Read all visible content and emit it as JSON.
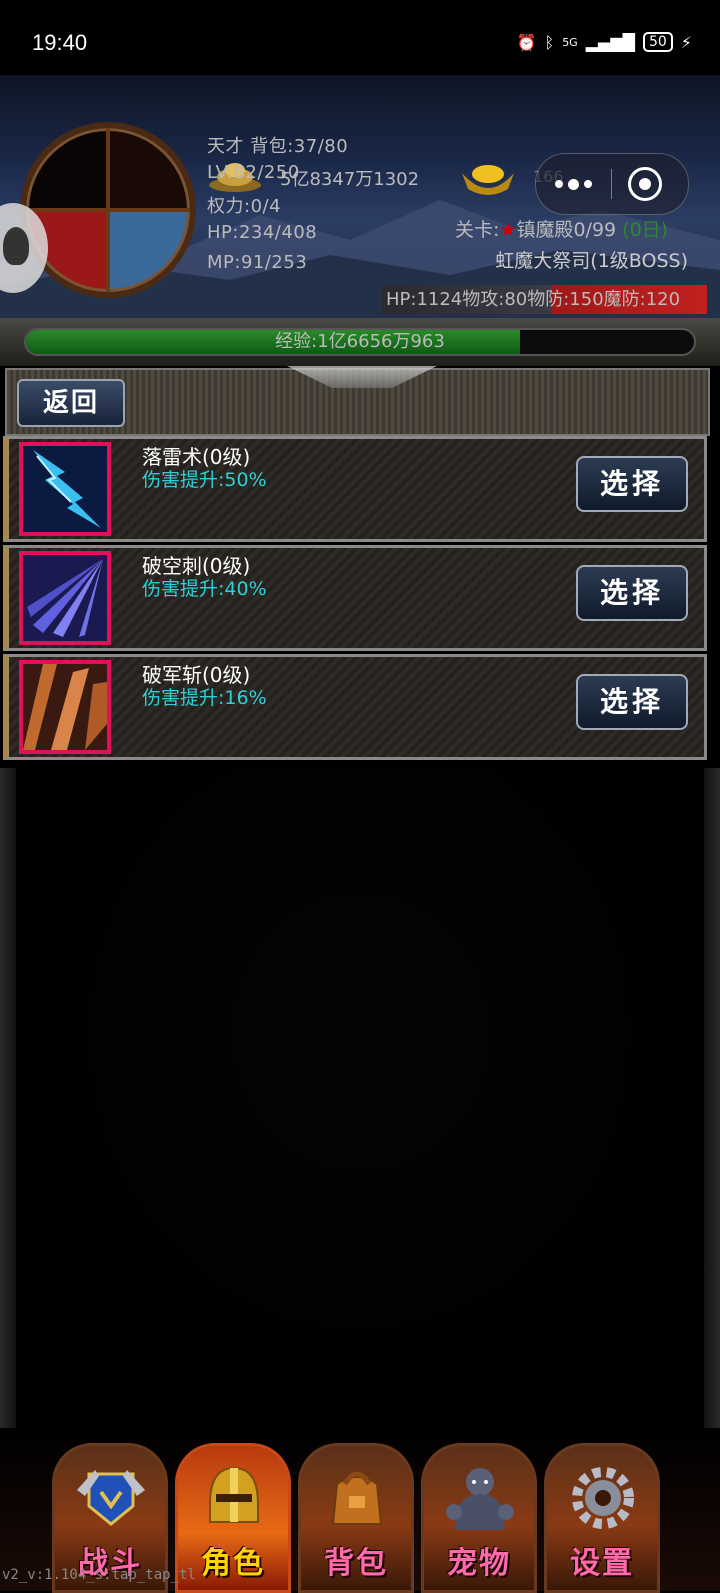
{
  "status_bar": {
    "time": "19:40",
    "network": "5G",
    "battery": "50"
  },
  "header": {
    "gold": "5亿8347万1302",
    "ingot": "166",
    "stats": [
      "天才 背包:37/80",
      "LV:82/250",
      "权力:0/4",
      "HP:234/408",
      "MP:91/253"
    ],
    "stage_label": "关卡:",
    "stage_name": "镇魔殿0/99",
    "stage_extra": "(0日)",
    "boss_name": "虹魔大祭司(1级BOSS)",
    "boss_stats": "HP:1124物攻:80物防:150魔防:120"
  },
  "exp": {
    "text": "经验:1亿6656万963",
    "progress": 0.74
  },
  "toolbar": {
    "back_label": "返回"
  },
  "skills": [
    {
      "name": "落雷术(0级)",
      "effect": "伤害提升:50%",
      "button": "选择",
      "icon": "lightning-icon"
    },
    {
      "name": "破空刺(0级)",
      "effect": "伤害提升:40%",
      "button": "选择",
      "icon": "spear-burst-icon"
    },
    {
      "name": "破军斩(0级)",
      "effect": "伤害提升:16%",
      "button": "选择",
      "icon": "slash-icon"
    }
  ],
  "nav": {
    "tabs": [
      {
        "label": "战斗",
        "icon": "battle-icon"
      },
      {
        "label": "角色",
        "icon": "helmet-icon",
        "active": true
      },
      {
        "label": "背包",
        "icon": "bag-icon"
      },
      {
        "label": "宠物",
        "icon": "gorilla-icon"
      },
      {
        "label": "设置",
        "icon": "gear-icon"
      }
    ]
  },
  "version": "v2_v:1.104_s:tap_tap_tl",
  "colors": {
    "skill_effect": "#2fd0d8",
    "icon_border": "#e0105a",
    "active_tab_label": "#ffd200",
    "tab_label": "#ff6aa8",
    "exp_fill": "#1e7a22"
  }
}
